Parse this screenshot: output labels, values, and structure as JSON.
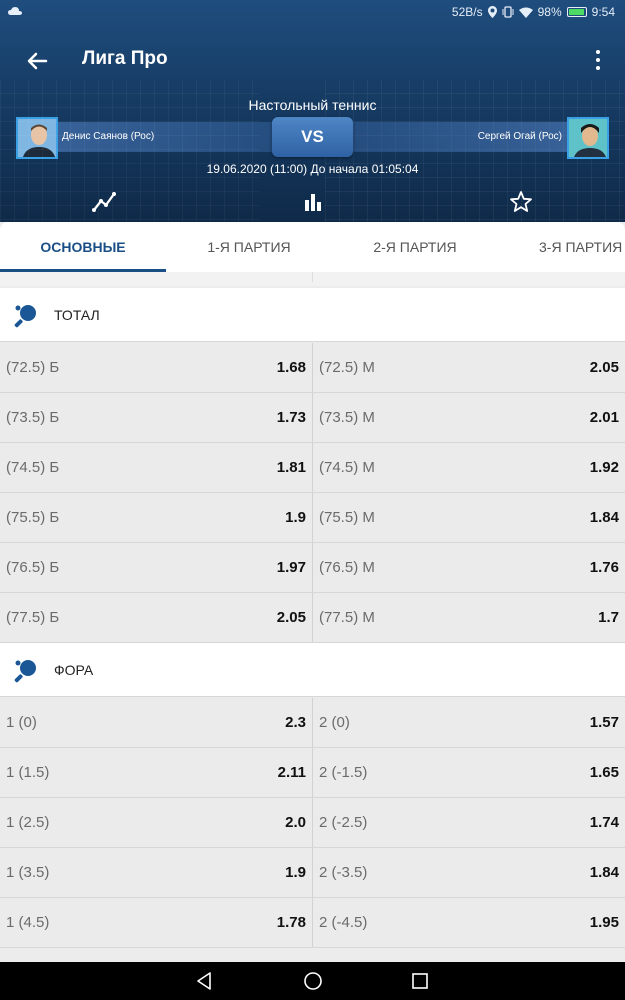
{
  "status": {
    "speed": "52B/s",
    "battery": "98%",
    "time": "9:54"
  },
  "toolbar": {
    "title": "Лига Про"
  },
  "match": {
    "sport": "Настольный теннис",
    "team1": "Денис Саянов (Рос)",
    "team2": "Сергей Огай (Рос)",
    "vs": "VS",
    "datetime": "19.06.2020 (11:00)  До начала 01:05:04"
  },
  "tabs": [
    "ОСНОВНЫЕ",
    "1-Я ПАРТИЯ",
    "2-Я ПАРТИЯ",
    "3-Я ПАРТИЯ"
  ],
  "sections": {
    "total": {
      "title": "ТОТАЛ",
      "rows": [
        {
          "l_label": "(72.5) Б",
          "l_odd": "1.68",
          "r_label": "(72.5) М",
          "r_odd": "2.05"
        },
        {
          "l_label": "(73.5) Б",
          "l_odd": "1.73",
          "r_label": "(73.5) М",
          "r_odd": "2.01"
        },
        {
          "l_label": "(74.5) Б",
          "l_odd": "1.81",
          "r_label": "(74.5) М",
          "r_odd": "1.92"
        },
        {
          "l_label": "(75.5) Б",
          "l_odd": "1.9",
          "r_label": "(75.5) М",
          "r_odd": "1.84"
        },
        {
          "l_label": "(76.5) Б",
          "l_odd": "1.97",
          "r_label": "(76.5) М",
          "r_odd": "1.76"
        },
        {
          "l_label": "(77.5) Б",
          "l_odd": "2.05",
          "r_label": "(77.5) М",
          "r_odd": "1.7"
        }
      ]
    },
    "handicap": {
      "title": "ФОРА",
      "rows": [
        {
          "l_label": "1 (0)",
          "l_odd": "2.3",
          "r_label": "2 (0)",
          "r_odd": "1.57"
        },
        {
          "l_label": "1 (1.5)",
          "l_odd": "2.11",
          "r_label": "2 (-1.5)",
          "r_odd": "1.65"
        },
        {
          "l_label": "1 (2.5)",
          "l_odd": "2.0",
          "r_label": "2 (-2.5)",
          "r_odd": "1.74"
        },
        {
          "l_label": "1 (3.5)",
          "l_odd": "1.9",
          "r_label": "2 (-3.5)",
          "r_odd": "1.84"
        },
        {
          "l_label": "1 (4.5)",
          "l_odd": "1.78",
          "r_label": "2 (-4.5)",
          "r_odd": "1.95"
        }
      ]
    }
  },
  "colors": {
    "accent": "#1a4f86",
    "header": "#163b63"
  }
}
